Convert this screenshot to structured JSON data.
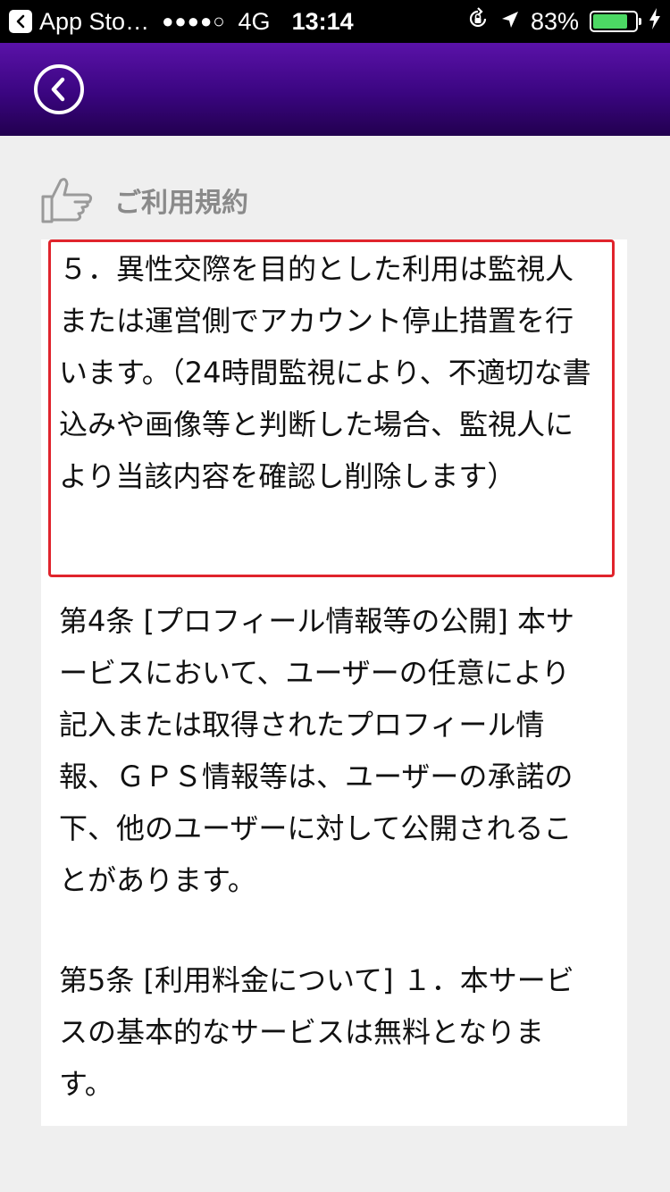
{
  "status_bar": {
    "back_app": "App Sto…",
    "signal": "●●●●○",
    "network": "4G",
    "time": "13:14",
    "battery": "83%",
    "battery_level": 0.83,
    "battery_color": "#4cd964"
  },
  "nav": {
    "back_icon": "chevron-left-circle-icon",
    "background_color": "#3a0580"
  },
  "section": {
    "icon": "thumbs-up-pointing-icon",
    "title": "ご利用規約"
  },
  "content": {
    "highlight_color": "#e0242c",
    "paragraphs": [
      "５．異性交際を目的とした利用は監視人または運営側でアカウント停止措置を行います。（24時間監視により、不適切な書込みや画像等と判断した場合、監視人により当該内容を確認し削除します）",
      "第4条 [プロフィール情報等の公開] 本サービスにおいて、ユーザーの任意により記入または取得されたプロフィール情報、ＧＰＳ情報等は、ユーザーの承諾の下、他のユーザーに対して公開されることがあります。",
      "第5条 [利用料金について] １．本サービスの基本的なサービスは無料となります。"
    ]
  }
}
